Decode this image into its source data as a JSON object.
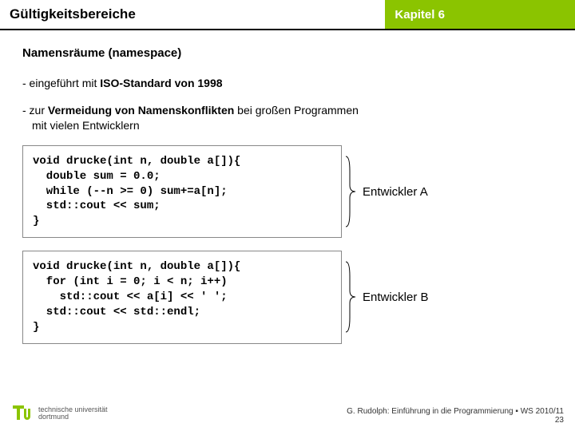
{
  "header": {
    "left": "Gültigkeitsbereiche",
    "right": "Kapitel 6"
  },
  "section_title": "Namensräume (namespace)",
  "bullets": {
    "b1_prefix": "- eingeführt mit ",
    "b1_bold": "ISO-Standard von 1998",
    "b2_prefix": "- zur ",
    "b2_bold": "Vermeidung von Namenskonflikten",
    "b2_rest": " bei großen Programmen",
    "b2_line2": "mit vielen Entwicklern"
  },
  "codeA": "void drucke(int n, double a[]){\n  double sum = 0.0;\n  while (--n >= 0) sum+=a[n];\n  std::cout << sum;\n}",
  "codeB": "void drucke(int n, double a[]){\n  for (int i = 0; i < n; i++)\n    std::cout << a[i] << ' ';\n  std::cout << std::endl;\n}",
  "devA": "Entwickler A",
  "devB": "Entwickler B",
  "logo": {
    "line1": "technische universität",
    "line2": "dortmund"
  },
  "footer": {
    "credit": "G. Rudolph: Einführung in die Programmierung ▪ WS 2010/11",
    "page": "23"
  }
}
